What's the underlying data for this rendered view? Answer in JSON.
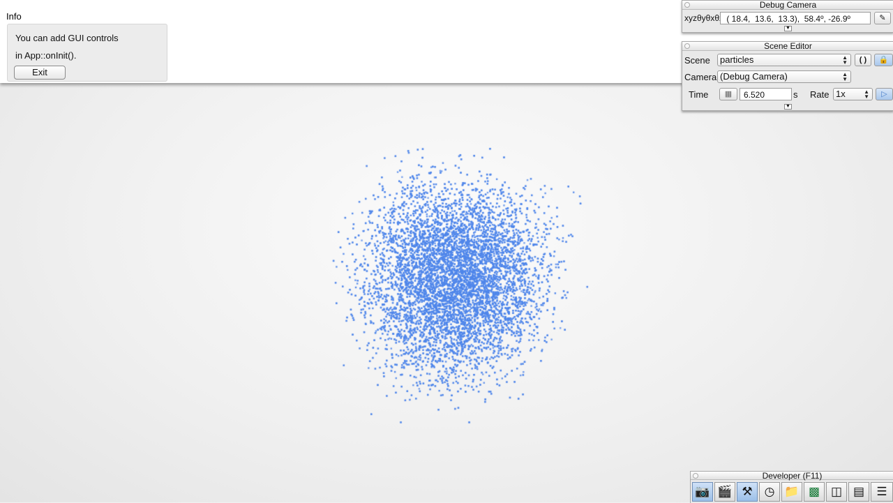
{
  "info": {
    "title": "Info",
    "line1": "You can add GUI controls",
    "line2": "in App::onInit().",
    "exit_label": "Exit"
  },
  "debug_camera": {
    "title": "Debug Camera",
    "label": "xyzθyθxθz",
    "value": " ( 18.4,  13.6,  13.3),  58.4º, -26.9º",
    "edit_icon": "pencil-icon"
  },
  "scene_editor": {
    "title": "Scene Editor",
    "scene_label": "Scene",
    "scene_value": "particles",
    "camera_label": "Camera",
    "camera_value": "(Debug Camera)",
    "time_label": "Time",
    "time_value": "6.520",
    "time_unit": "s",
    "rate_label": "Rate",
    "rate_value": "1x",
    "reload_icon": "reload-icon",
    "lock_icon": "lock-icon",
    "play_icon": "play-icon"
  },
  "developer": {
    "title": "Developer (F11)",
    "icons": [
      "camera-icon",
      "clapperboard-icon",
      "tools-icon",
      "clock-icon",
      "folder-icon",
      "terminal-icon",
      "network-icon",
      "profiler-icon",
      "document-icon"
    ]
  },
  "colors": {
    "particle": "#4f86ea",
    "accent_toggle": "#9bbfe8"
  }
}
